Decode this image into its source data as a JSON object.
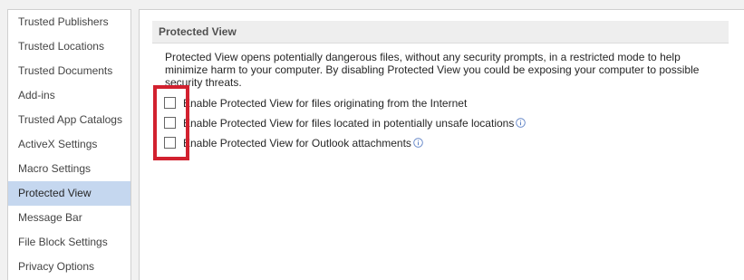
{
  "sidebar": {
    "items": [
      {
        "label": "Trusted Publishers",
        "selected": false
      },
      {
        "label": "Trusted Locations",
        "selected": false
      },
      {
        "label": "Trusted Documents",
        "selected": false
      },
      {
        "label": "Add-ins",
        "selected": false
      },
      {
        "label": "Trusted App Catalogs",
        "selected": false
      },
      {
        "label": "ActiveX Settings",
        "selected": false
      },
      {
        "label": "Macro Settings",
        "selected": false
      },
      {
        "label": "Protected View",
        "selected": true
      },
      {
        "label": "Message Bar",
        "selected": false
      },
      {
        "label": "File Block Settings",
        "selected": false
      },
      {
        "label": "Privacy Options",
        "selected": false
      }
    ]
  },
  "main": {
    "section_title": "Protected View",
    "description": "Protected View opens potentially dangerous files, without any security prompts, in a restricted mode to help minimize harm to your computer. By disabling Protected View you could be exposing your computer to possible security threats.",
    "options": [
      {
        "label": "Enable Protected View for files originating from the Internet",
        "checked": false,
        "has_info_icon": false
      },
      {
        "label": "Enable Protected View for files located in potentially unsafe locations",
        "checked": false,
        "has_info_icon": true
      },
      {
        "label": "Enable Protected View for Outlook attachments",
        "checked": false,
        "has_info_icon": true
      }
    ]
  },
  "colors": {
    "selected_item_bg": "#c5d7ef",
    "highlight_border": "#d2212f",
    "info_icon": "#5b7fc4"
  }
}
